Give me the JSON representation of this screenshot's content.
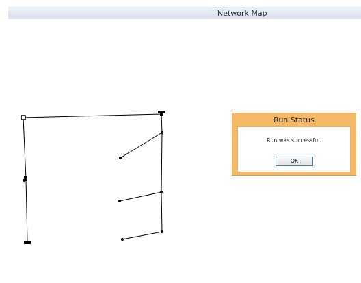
{
  "window": {
    "title": "Network Map"
  },
  "dialog": {
    "title": "Run Status",
    "message": "Run was successful.",
    "ok_label": "OK",
    "accent_color": "#f5b866"
  }
}
